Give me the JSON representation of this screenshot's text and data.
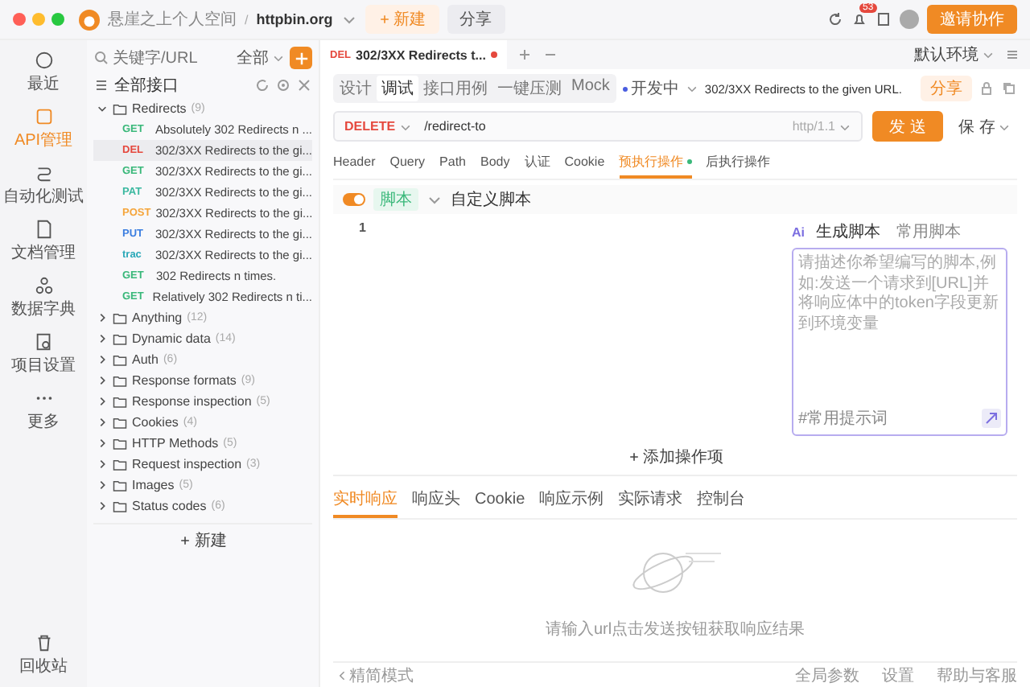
{
  "titlebar": {
    "workspace": "悬崖之上个人空间",
    "separator": "/",
    "project": "httpbin.org",
    "new_button": "新建",
    "share_button": "分享",
    "notification_count": "53",
    "invite_button": "邀请协作"
  },
  "nav": [
    {
      "label": "最近",
      "selected": false
    },
    {
      "label": "API管理",
      "selected": true
    },
    {
      "label": "自动化测试",
      "selected": false
    },
    {
      "label": "文档管理",
      "selected": false
    },
    {
      "label": "数据字典",
      "selected": false
    },
    {
      "label": "项目设置",
      "selected": false
    },
    {
      "label": "更多",
      "selected": false
    }
  ],
  "trash": "回收站",
  "tree": {
    "search_placeholder": "关键字/URL",
    "filter": "全部",
    "root": "全部接口",
    "new_button": "新建",
    "folders": [
      {
        "name": "Redirects",
        "count": "(9)",
        "expanded": true,
        "children": [
          {
            "method": "GET",
            "color": "#3ab87a",
            "name": "Absolutely 302 Redirects n ...",
            "selected": false
          },
          {
            "method": "DEL",
            "color": "#e5483d",
            "name": "302/3XX Redirects to the gi...",
            "selected": true
          },
          {
            "method": "GET",
            "color": "#3ab87a",
            "name": "302/3XX Redirects to the gi...",
            "selected": false
          },
          {
            "method": "PAT",
            "color": "#3bb8a0",
            "name": "302/3XX Redirects to the gi...",
            "selected": false
          },
          {
            "method": "POST",
            "color": "#f5a53b",
            "name": "302/3XX Redirects to the gi...",
            "selected": false
          },
          {
            "method": "PUT",
            "color": "#3b7ee0",
            "name": "302/3XX Redirects to the gi...",
            "selected": false
          },
          {
            "method": "trac",
            "color": "#2aa8b8",
            "name": "302/3XX Redirects to the gi...",
            "selected": false
          },
          {
            "method": "GET",
            "color": "#3ab87a",
            "name": "302 Redirects n times.",
            "selected": false
          },
          {
            "method": "GET",
            "color": "#3ab87a",
            "name": "Relatively 302 Redirects n ti...",
            "selected": false
          }
        ]
      },
      {
        "name": "Anything",
        "count": "(12)",
        "expanded": false
      },
      {
        "name": "Dynamic data",
        "count": "(14)",
        "expanded": false
      },
      {
        "name": "Auth",
        "count": "(6)",
        "expanded": false
      },
      {
        "name": "Response formats",
        "count": "(9)",
        "expanded": false
      },
      {
        "name": "Response inspection",
        "count": "(5)",
        "expanded": false
      },
      {
        "name": "Cookies",
        "count": "(4)",
        "expanded": false
      },
      {
        "name": "HTTP Methods",
        "count": "(5)",
        "expanded": false
      },
      {
        "name": "Request inspection",
        "count": "(3)",
        "expanded": false
      },
      {
        "name": "Images",
        "count": "(5)",
        "expanded": false
      },
      {
        "name": "Status codes",
        "count": "(6)",
        "expanded": false
      }
    ]
  },
  "request_tab": {
    "method": "DEL",
    "title": "302/3XX Redirects t...",
    "unsaved": true
  },
  "environment": "默认环境",
  "modes": [
    {
      "label": "设计",
      "selected": false
    },
    {
      "label": "调试",
      "selected": true
    },
    {
      "label": "接口用例",
      "selected": false
    },
    {
      "label": "一键压测",
      "selected": false
    },
    {
      "label": "Mock",
      "selected": false
    }
  ],
  "status": "开发中",
  "api_title": "302/3XX Redirects to the given URL.",
  "share": "分享",
  "url": {
    "method": "DELETE",
    "path": "/redirect-to",
    "protocol": "http/1.1",
    "send": "发 送",
    "save": "保 存"
  },
  "param_tabs": [
    {
      "label": "Header",
      "selected": false,
      "modified": false
    },
    {
      "label": "Query",
      "selected": false,
      "modified": false
    },
    {
      "label": "Path",
      "selected": false,
      "modified": false
    },
    {
      "label": "Body",
      "selected": false,
      "modified": false
    },
    {
      "label": "认证",
      "selected": false,
      "modified": false
    },
    {
      "label": "Cookie",
      "selected": false,
      "modified": false
    },
    {
      "label": "预执行操作",
      "selected": true,
      "modified": true
    },
    {
      "label": "后执行操作",
      "selected": false,
      "modified": false
    }
  ],
  "script": {
    "enabled": true,
    "tag": "脚本",
    "name": "自定义脚本",
    "line_number": "1",
    "ai_badge": "Ai",
    "ai_tabs": [
      {
        "label": "生成脚本",
        "selected": true
      },
      {
        "label": "常用脚本",
        "selected": false
      }
    ],
    "ai_placeholder": "请描述你希望编写的脚本,例如:发送一个请求到[URL]并将响应体中的token字段更新到环境变量",
    "ai_hint": "#常用提示词"
  },
  "add_action": "添加操作项",
  "response_tabs": [
    {
      "label": "实时响应",
      "selected": true
    },
    {
      "label": "响应头",
      "selected": false
    },
    {
      "label": "Cookie",
      "selected": false
    },
    {
      "label": "响应示例",
      "selected": false
    },
    {
      "label": "实际请求",
      "selected": false
    },
    {
      "label": "控制台",
      "selected": false
    }
  ],
  "response_empty": "请输入url点击发送按钮获取响应结果",
  "status_bar": {
    "mode": "精简模式",
    "items": [
      "全局参数",
      "设置",
      "帮助与客服"
    ]
  }
}
